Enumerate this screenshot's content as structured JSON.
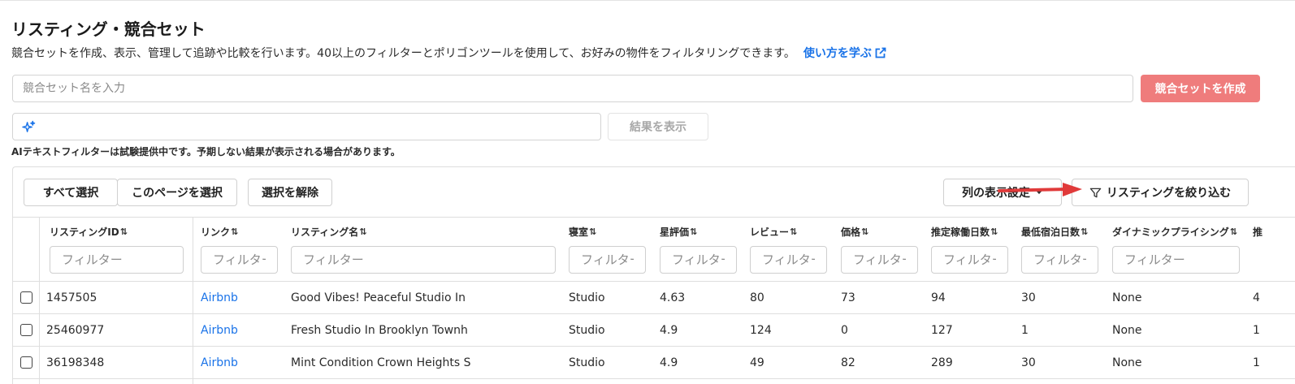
{
  "header": {
    "title": "リスティング・競合セット",
    "description": "競合セットを作成、表示、管理して追跡や比較を行います。40以上のフィルターとポリゴンツールを使用して、お好みの物件をフィルタリングできます。",
    "learn_link": "使い方を学ぶ"
  },
  "create_set": {
    "placeholder": "競合セット名を入力",
    "button_label": "競合セットを作成"
  },
  "ai_filter": {
    "placeholder": "",
    "button_label": "結果を表示",
    "note": "AIテキストフィルターは試験提供中です。予期しない結果が表示される場合があります。"
  },
  "toolbar": {
    "select_all": "すべて選択",
    "select_page": "このページを選択",
    "deselect": "選択を解除",
    "column_settings": "列の表示設定",
    "filter_listings": "リスティングを絞り込む"
  },
  "colors": {
    "accent_link": "#1a73e8",
    "create_button": "#ef7c7c",
    "annotation_arrow": "#e03a3a"
  },
  "table": {
    "sort_icon": "⇅",
    "filter_placeholder": "フィルター",
    "columns": [
      {
        "label": "リスティングID"
      },
      {
        "label": "リンク"
      },
      {
        "label": "リスティング名"
      },
      {
        "label": "寝室"
      },
      {
        "label": "星評価"
      },
      {
        "label": "レビュー"
      },
      {
        "label": "価格"
      },
      {
        "label": "推定稼働日数"
      },
      {
        "label": "最低宿泊日数"
      },
      {
        "label": "ダイナミックプライシング"
      },
      {
        "label": "推"
      }
    ],
    "rows": [
      {
        "id": "1457505",
        "link": "Airbnb",
        "name": "Good Vibes! Peaceful Studio In",
        "bedrooms": "Studio",
        "rating": "4.63",
        "reviews": "80",
        "price": "73",
        "occupancy": "94",
        "min_nights": "30",
        "dynamic": "None",
        "extra": "4"
      },
      {
        "id": "25460977",
        "link": "Airbnb",
        "name": "Fresh Studio In Brooklyn Townh",
        "bedrooms": "Studio",
        "rating": "4.9",
        "reviews": "124",
        "price": "0",
        "occupancy": "127",
        "min_nights": "1",
        "dynamic": "None",
        "extra": "1"
      },
      {
        "id": "36198348",
        "link": "Airbnb",
        "name": "Mint Condition Crown Heights S",
        "bedrooms": "Studio",
        "rating": "4.9",
        "reviews": "49",
        "price": "82",
        "occupancy": "289",
        "min_nights": "30",
        "dynamic": "None",
        "extra": "1"
      }
    ]
  }
}
